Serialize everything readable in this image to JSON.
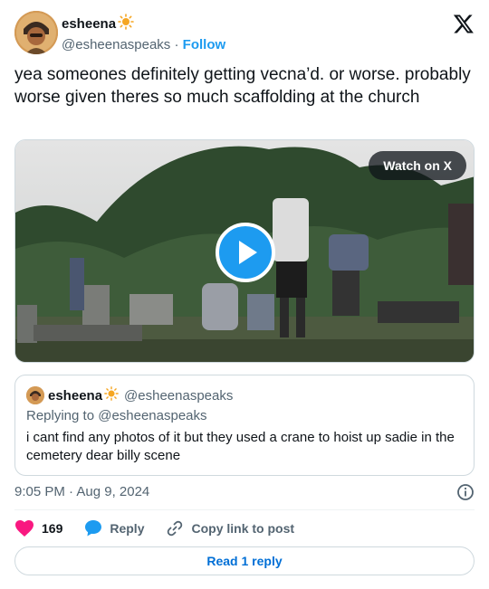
{
  "author": {
    "display_name": "esheena",
    "handle": "@esheenaspeaks",
    "follow_label": "Follow",
    "separator": "·"
  },
  "tweet": {
    "text": "yea someones definitely getting vecna’d. or worse. probably worse given theres so much scaffolding at the church"
  },
  "media": {
    "watch_label": "Watch on X"
  },
  "quote": {
    "display_name": "esheena",
    "handle": "@esheenaspeaks",
    "replying_to": "Replying to @esheenaspeaks",
    "text": "i cant find any photos of it but they used a crane to hoist up sadie in the cemetery dear billy scene"
  },
  "meta": {
    "timestamp": "9:05 PM · Aug 9, 2024"
  },
  "actions": {
    "likes": "169",
    "reply_label": "Reply",
    "copy_label": "Copy link to post"
  },
  "footer": {
    "read_label": "Read 1 reply"
  },
  "icons": {
    "like": "heart-icon",
    "reply": "speech-bubble-icon",
    "copy": "link-icon",
    "info": "info-icon",
    "brand": "x-logo-icon",
    "emoji": "sun-emoji"
  },
  "colors": {
    "accent": "#1d9bf0",
    "like": "#f91880",
    "link": "#006fd6",
    "muted": "#536471"
  }
}
